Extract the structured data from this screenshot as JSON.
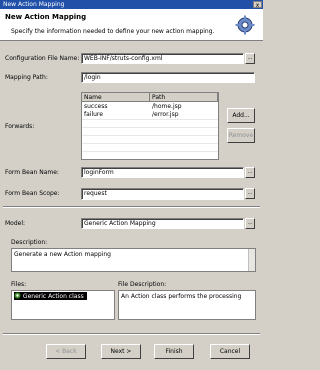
{
  "window": {
    "title": "New Action Mapping",
    "close_glyph": "x"
  },
  "header": {
    "title": "New Action Mapping",
    "subtitle": "Specify the information needed to define your new action mapping.",
    "icon": "gear-icon"
  },
  "form": {
    "config_file_label": "Configuration File Name:",
    "config_file_value": "WEB-INF/struts-config.xml",
    "mapping_path_label": "Mapping Path:",
    "mapping_path_value": "/login",
    "forwards_label": "Forwards:",
    "forwards_table": {
      "columns": [
        "Name",
        "Path"
      ],
      "rows": [
        {
          "name": "success",
          "path": "/home.jsp"
        },
        {
          "name": "failure",
          "path": "/error.jsp"
        }
      ]
    },
    "add_button": "Add...",
    "remove_button": "Remove",
    "form_bean_name_label": "Form Bean Name:",
    "form_bean_name_value": "loginForm",
    "form_bean_scope_label": "Form Bean Scope:",
    "form_bean_scope_value": "request",
    "browse_glyph": "..."
  },
  "model": {
    "label": "Model:",
    "value": "Generic Action Mapping",
    "description_label": "Description:",
    "description_value": "Generate a new Action mapping",
    "files_label": "Files:",
    "files_items": [
      "Generic Action class"
    ],
    "file_description_label": "File Description:",
    "file_description_value": "An Action class performs the processing"
  },
  "footer": {
    "back": "< Back",
    "next": "Next >",
    "finish": "Finish",
    "cancel": "Cancel"
  },
  "colors": {
    "titlebar": "#2050a8",
    "dialog_bg": "#d4d0c8",
    "selection": "#000000"
  }
}
